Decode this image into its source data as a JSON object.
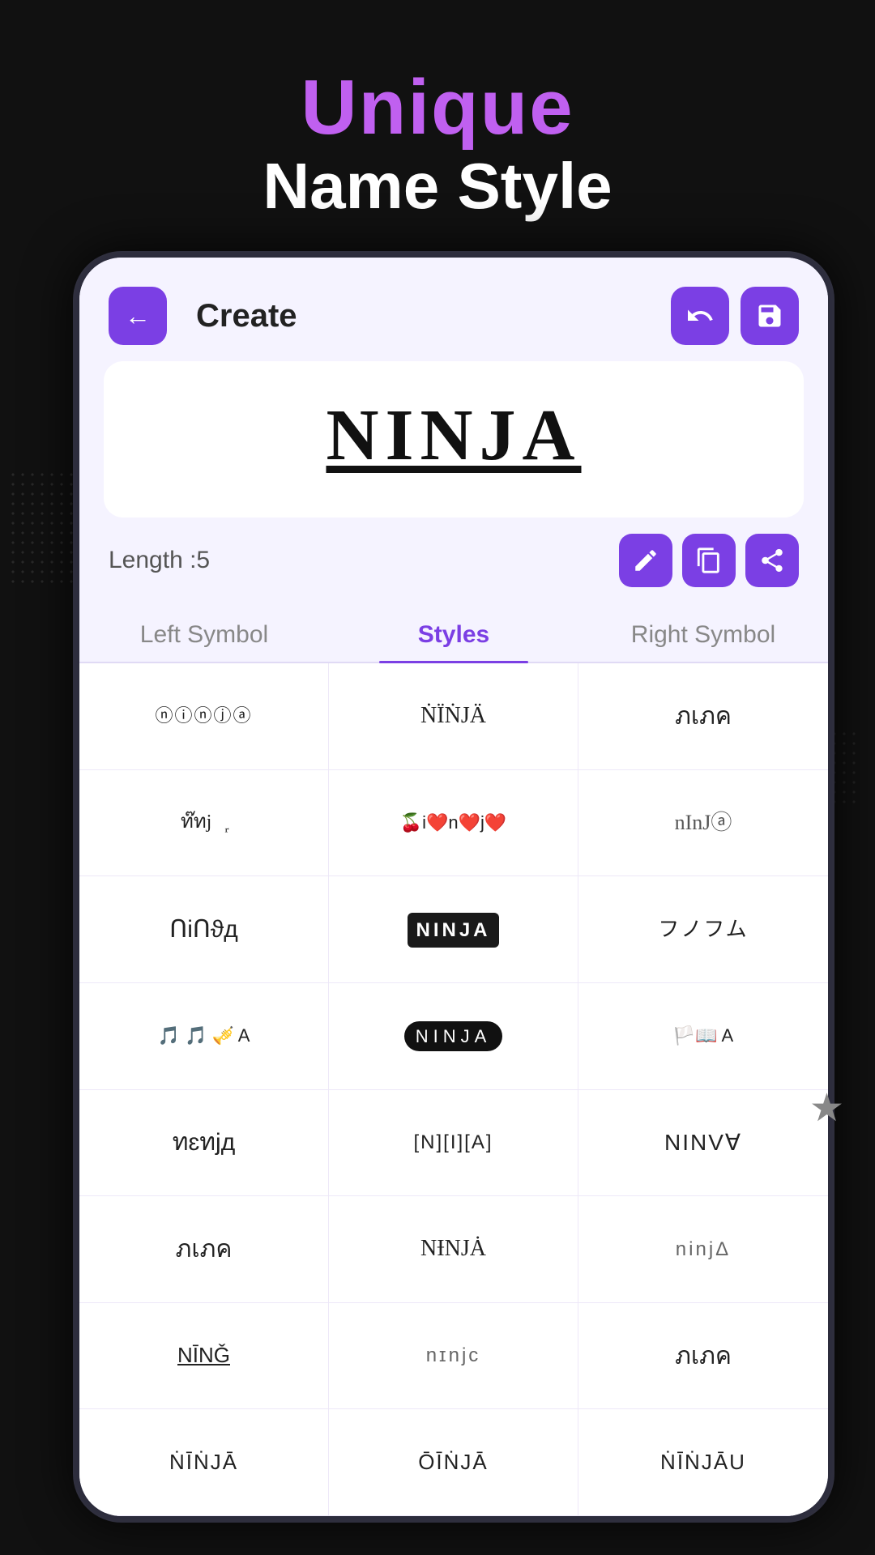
{
  "app": {
    "title": "Unique",
    "subtitle": "Name Style"
  },
  "header": {
    "back_label": "←",
    "create_label": "Create"
  },
  "preview": {
    "text": "NINJA",
    "length_label": "Length :5"
  },
  "tabs": [
    {
      "label": "Left Symbol",
      "active": false
    },
    {
      "label": "Styles",
      "active": true
    },
    {
      "label": "Right Symbol",
      "active": false
    }
  ],
  "styles": [
    {
      "text": "ⓝⓘⓝⓙⓐ",
      "class": "circled"
    },
    {
      "text": "ṄÏṄJÄ",
      "class": "decorative"
    },
    {
      "text": "ภเภค",
      "class": "armenian"
    },
    {
      "text": "ท๊ทjล᷊",
      "class": "decorative"
    },
    {
      "text": "🍒i❤️n❤️j❤️a",
      "class": "emoji-mix"
    },
    {
      "text": "nInJⓐ",
      "class": "cursive-mix"
    },
    {
      "text": "ՈiՈϑд",
      "class": "armenian"
    },
    {
      "text": "NINJA",
      "class": "bold-box"
    },
    {
      "text": "フノフム",
      "class": "katakana"
    },
    {
      "text": "🎵 🎵 🎺 A",
      "class": "music-mix"
    },
    {
      "text": "NINJA",
      "class": "bold-circle-dark"
    },
    {
      "text": "🏳️📖 A",
      "class": "flags-mix"
    },
    {
      "text": "ทɛทjд",
      "class": "armenian"
    },
    {
      "text": "[N][I][A]",
      "class": "bracket-style"
    },
    {
      "text": "NINV∀",
      "class": "mirror"
    },
    {
      "text": "ภเภค",
      "class": "armenian"
    },
    {
      "text": "NƗNJȦ",
      "class": "serif-fancy"
    },
    {
      "text": "ninjΔ",
      "class": "small-style"
    },
    {
      "text": "NĪNǦ",
      "class": "underline-style"
    },
    {
      "text": "nɪnjc",
      "class": "small-style"
    },
    {
      "text": "ภเภค",
      "class": "armenian"
    },
    {
      "text": "ṄĪṄJĀ",
      "class": "bottom-row-text"
    },
    {
      "text": "ŌĪṄJĀ",
      "class": "bottom-row-text"
    },
    {
      "text": "ṄĪṄJĀU",
      "class": "bottom-row-text"
    }
  ],
  "icons": {
    "back": "arrow-left-icon",
    "undo": "undo-icon",
    "save": "save-icon",
    "edit": "edit-icon",
    "copy": "copy-icon",
    "share": "share-icon"
  },
  "colors": {
    "accent": "#7b3fe4",
    "background": "#111111",
    "surface": "#f5f3ff",
    "text_primary": "#222222",
    "text_secondary": "#888888"
  }
}
